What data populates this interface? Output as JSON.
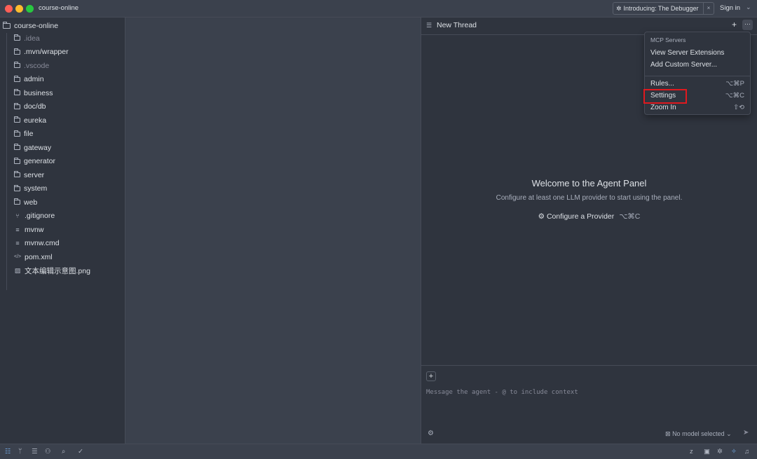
{
  "window": {
    "project_title": "course-online"
  },
  "banner": {
    "text": "Introducing: The Debugger",
    "close": "×"
  },
  "auth": {
    "sign_in": "Sign in",
    "chevron": "⌄"
  },
  "sidebar": {
    "root": "course-online",
    "items": [
      {
        "label": ".idea",
        "type": "folder",
        "dim": true
      },
      {
        "label": ".mvn/wrapper",
        "type": "folder",
        "dim": false
      },
      {
        "label": ".vscode",
        "type": "folder",
        "dim": true
      },
      {
        "label": "admin",
        "type": "folder",
        "dim": false
      },
      {
        "label": "business",
        "type": "folder",
        "dim": false
      },
      {
        "label": "doc/db",
        "type": "folder",
        "dim": false
      },
      {
        "label": "eureka",
        "type": "folder",
        "dim": false
      },
      {
        "label": "file",
        "type": "folder",
        "dim": false
      },
      {
        "label": "gateway",
        "type": "folder",
        "dim": false
      },
      {
        "label": "generator",
        "type": "folder",
        "dim": false
      },
      {
        "label": "server",
        "type": "folder",
        "dim": false
      },
      {
        "label": "system",
        "type": "folder",
        "dim": false
      },
      {
        "label": "web",
        "type": "folder",
        "dim": false
      },
      {
        "label": ".gitignore",
        "type": "git",
        "dim": false
      },
      {
        "label": "mvnw",
        "type": "text",
        "dim": false
      },
      {
        "label": "mvnw.cmd",
        "type": "text",
        "dim": false
      },
      {
        "label": "pom.xml",
        "type": "code",
        "dim": false
      },
      {
        "label": "文本编辑示意图.png",
        "type": "image",
        "dim": false
      }
    ]
  },
  "agent": {
    "thread_title": "New Thread",
    "plus": "+",
    "more": "···",
    "welcome_title": "Welcome to the Agent Panel",
    "welcome_sub": "Configure at least one LLM provider to start using the panel.",
    "configure_label": "Configure a Provider",
    "configure_shortcut": "⌥⌘C",
    "add_context": "+",
    "message_placeholder": "Message the agent - @ to include context",
    "model_label": "No model selected"
  },
  "menu": {
    "header": "MCP Servers",
    "view_extensions": "View Server Extensions",
    "add_custom": "Add Custom Server...",
    "rules": "Rules...",
    "rules_key": "⌥⌘P",
    "settings": "Settings",
    "settings_key": "⌥⌘C",
    "zoom_in": "Zoom In",
    "zoom_key": "⇧⟲"
  },
  "highlight_color": "#e0191e"
}
